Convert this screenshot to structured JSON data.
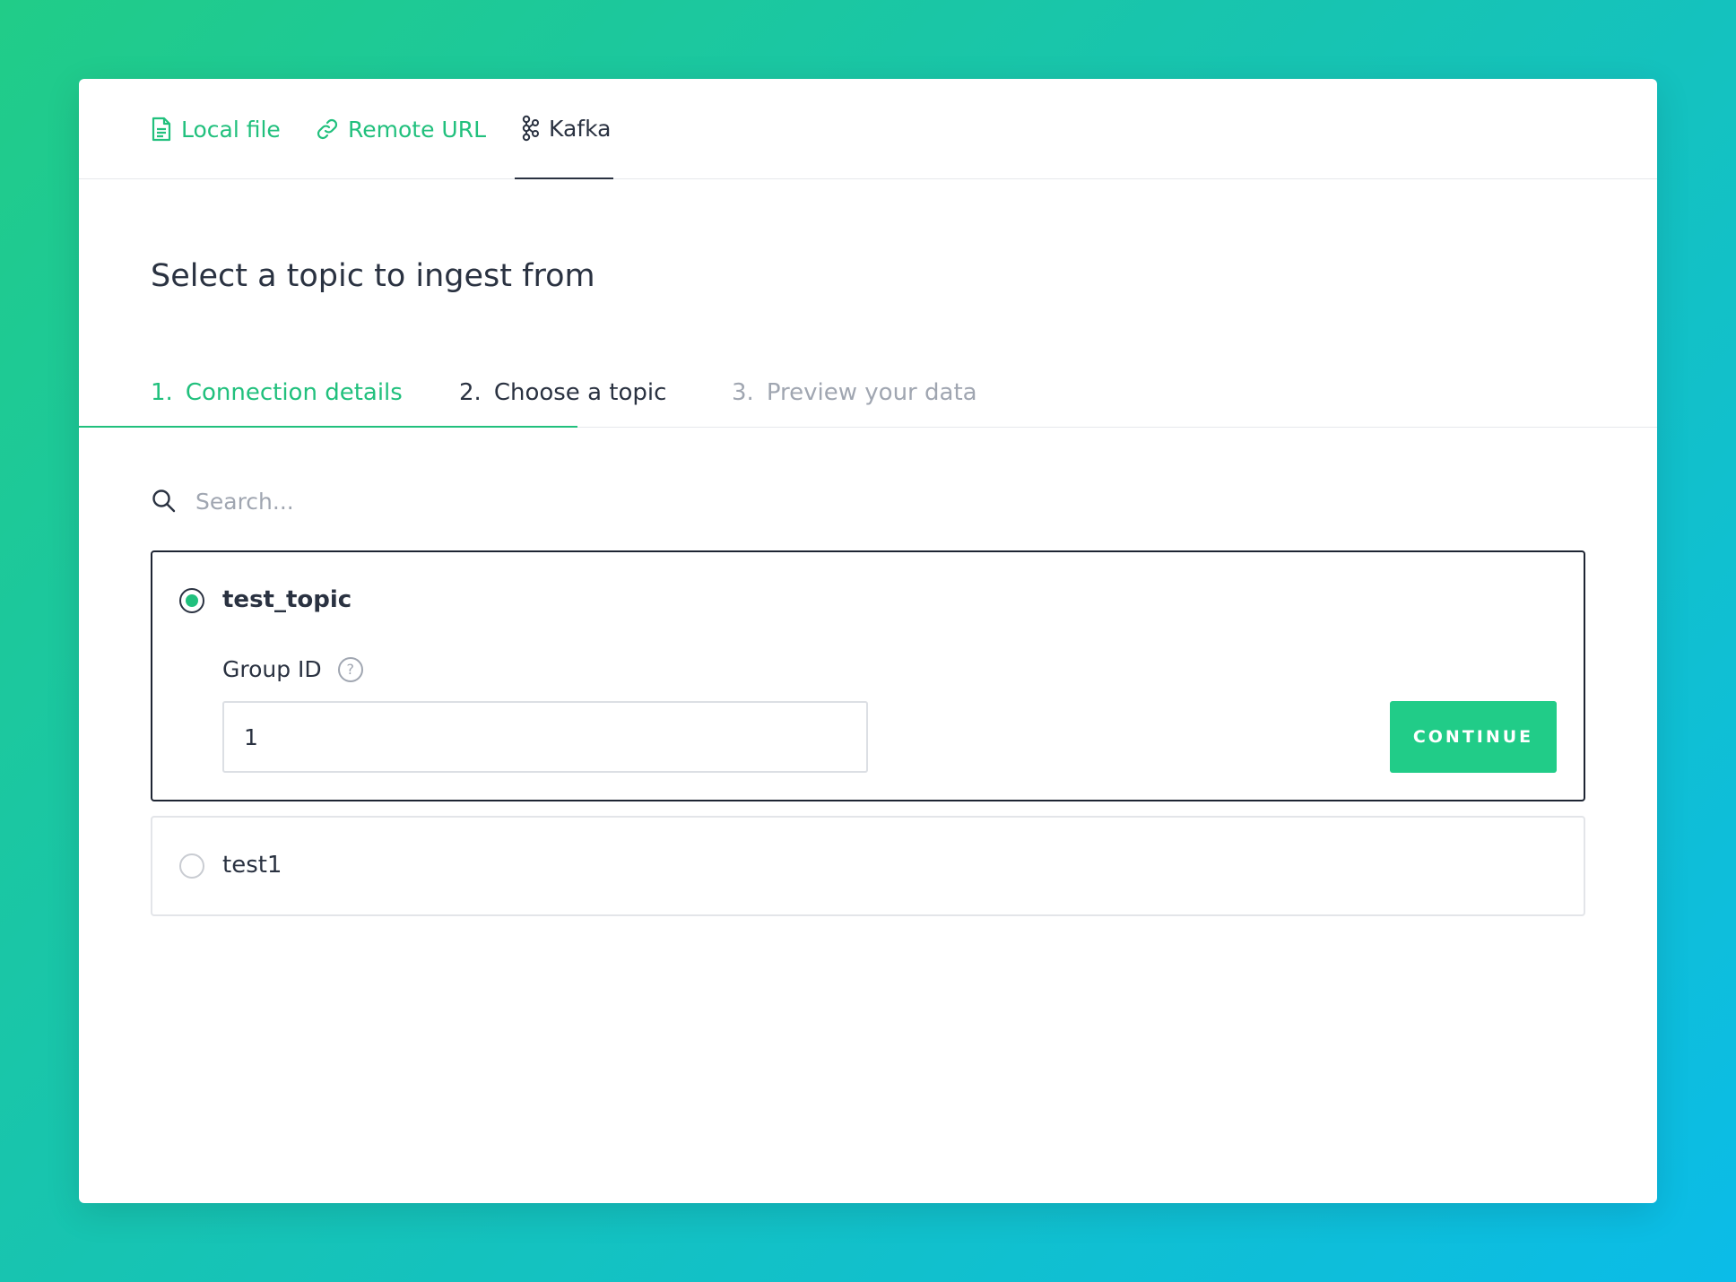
{
  "source_tabs": [
    {
      "label": "Local file",
      "icon": "file-icon",
      "state": "link"
    },
    {
      "label": "Remote URL",
      "icon": "link-icon",
      "state": "link"
    },
    {
      "label": "Kafka",
      "icon": "kafka-icon",
      "state": "active"
    }
  ],
  "title": "Select a topic to ingest from",
  "steps": [
    {
      "num": "1.",
      "label": "Connection details",
      "state": "done"
    },
    {
      "num": "2.",
      "label": "Choose a topic",
      "state": "current"
    },
    {
      "num": "3.",
      "label": "Preview your data",
      "state": "upcoming"
    }
  ],
  "search": {
    "placeholder": "Search...",
    "value": "",
    "icon": "search-icon"
  },
  "topics": [
    {
      "name": "test_topic",
      "selected": true,
      "group_id_label": "Group ID",
      "group_id_help": "?",
      "group_id_value": "1",
      "continue_label": "CONTINUE"
    },
    {
      "name": "test1",
      "selected": false
    }
  ],
  "colors": {
    "accent": "#21cc88",
    "text": "#2a3241",
    "muted": "#a0a6b1"
  }
}
